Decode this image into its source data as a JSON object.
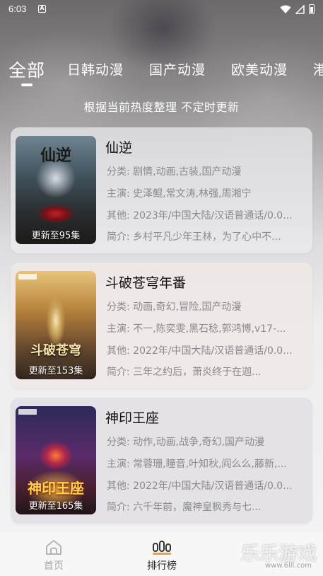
{
  "status_bar": {
    "time": "6:03",
    "notification_letter": "A"
  },
  "tabs": [
    {
      "label": "全部",
      "active": true
    },
    {
      "label": "日韩动漫",
      "active": false
    },
    {
      "label": "国产动漫",
      "active": false
    },
    {
      "label": "欧美动漫",
      "active": false
    },
    {
      "label": "港",
      "active": false
    }
  ],
  "subtitle": "根据当前热度整理 不定时更新",
  "items": [
    {
      "title": "仙逆",
      "poster_title": "仙逆",
      "update": "更新至95集",
      "category": "分类:  剧情,动画,古装,国产动漫",
      "cast": "主演:  史泽鲲,常文涛,林强,周湘宁",
      "other": "其他:  2023年/中国大陆/汉语普通话/0.0...",
      "intro": "简介:  乡村平凡少年王林，为了心中不..."
    },
    {
      "title": "斗破苍穹年番",
      "poster_title": "斗破苍穹",
      "update": "更新至153集",
      "category": "分类:  动画,奇幻,冒险,国产动漫",
      "cast": "主演:  不一,陈奕雯,黑石稔,郭鸿博,v17-...",
      "other": "其他:  2022年/中国大陆/汉语普通话/0.0...",
      "intro": "简介:          三年之约后，萧炎终于在迦..."
    },
    {
      "title": "神印王座",
      "poster_title": "神印王座",
      "update": "更新至165集",
      "category": "分类:  动作,动画,战争,奇幻,国产动漫",
      "cast": "主演:  常蓉珊,瞳音,叶知秋,阎么么,藤新,...",
      "other": "其他:  2022年/中国大陆/汉语普通话/0.0...",
      "intro": "简介:          六千年前，魔神皇枫秀与七..."
    }
  ],
  "bottom_nav": {
    "home_label": "首页",
    "rank_label": "排行榜"
  },
  "watermark": {
    "text": "乐乐游戏",
    "site": "www.6lll.com"
  },
  "colors": {
    "active_text": "#222222",
    "inactive_text": "#a9a9ad",
    "rank_icon_accent": "#e8a33a"
  }
}
